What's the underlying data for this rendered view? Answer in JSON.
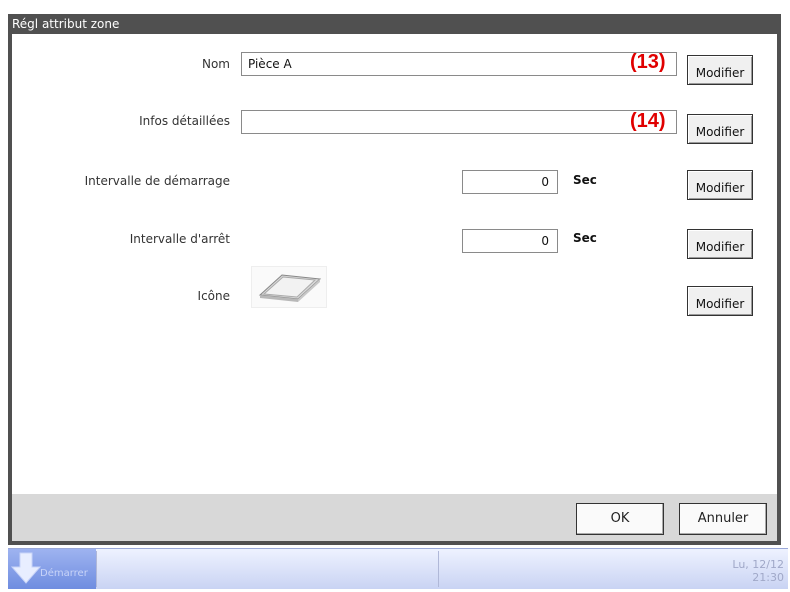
{
  "window": {
    "title": "Régl attribut zone"
  },
  "form": {
    "nom_label": "Nom",
    "nom_value": "Pièce A",
    "infos_label": "Infos détaillées",
    "infos_value": "",
    "start_interval_label": "Intervalle de démarrage",
    "start_interval_value": "0",
    "stop_interval_label": "Intervalle d'arrêt",
    "stop_interval_value": "0",
    "unit": "Sec",
    "icon_label": "Icône",
    "modify_label": "Modifier"
  },
  "annotations": {
    "a13": "(13)",
    "a14": "(14)"
  },
  "footer": {
    "ok_label": "OK",
    "cancel_label": "Annuler"
  },
  "taskbar": {
    "start_label": "Démarrer",
    "date": "Lu, 12/12",
    "time": "21:30"
  }
}
